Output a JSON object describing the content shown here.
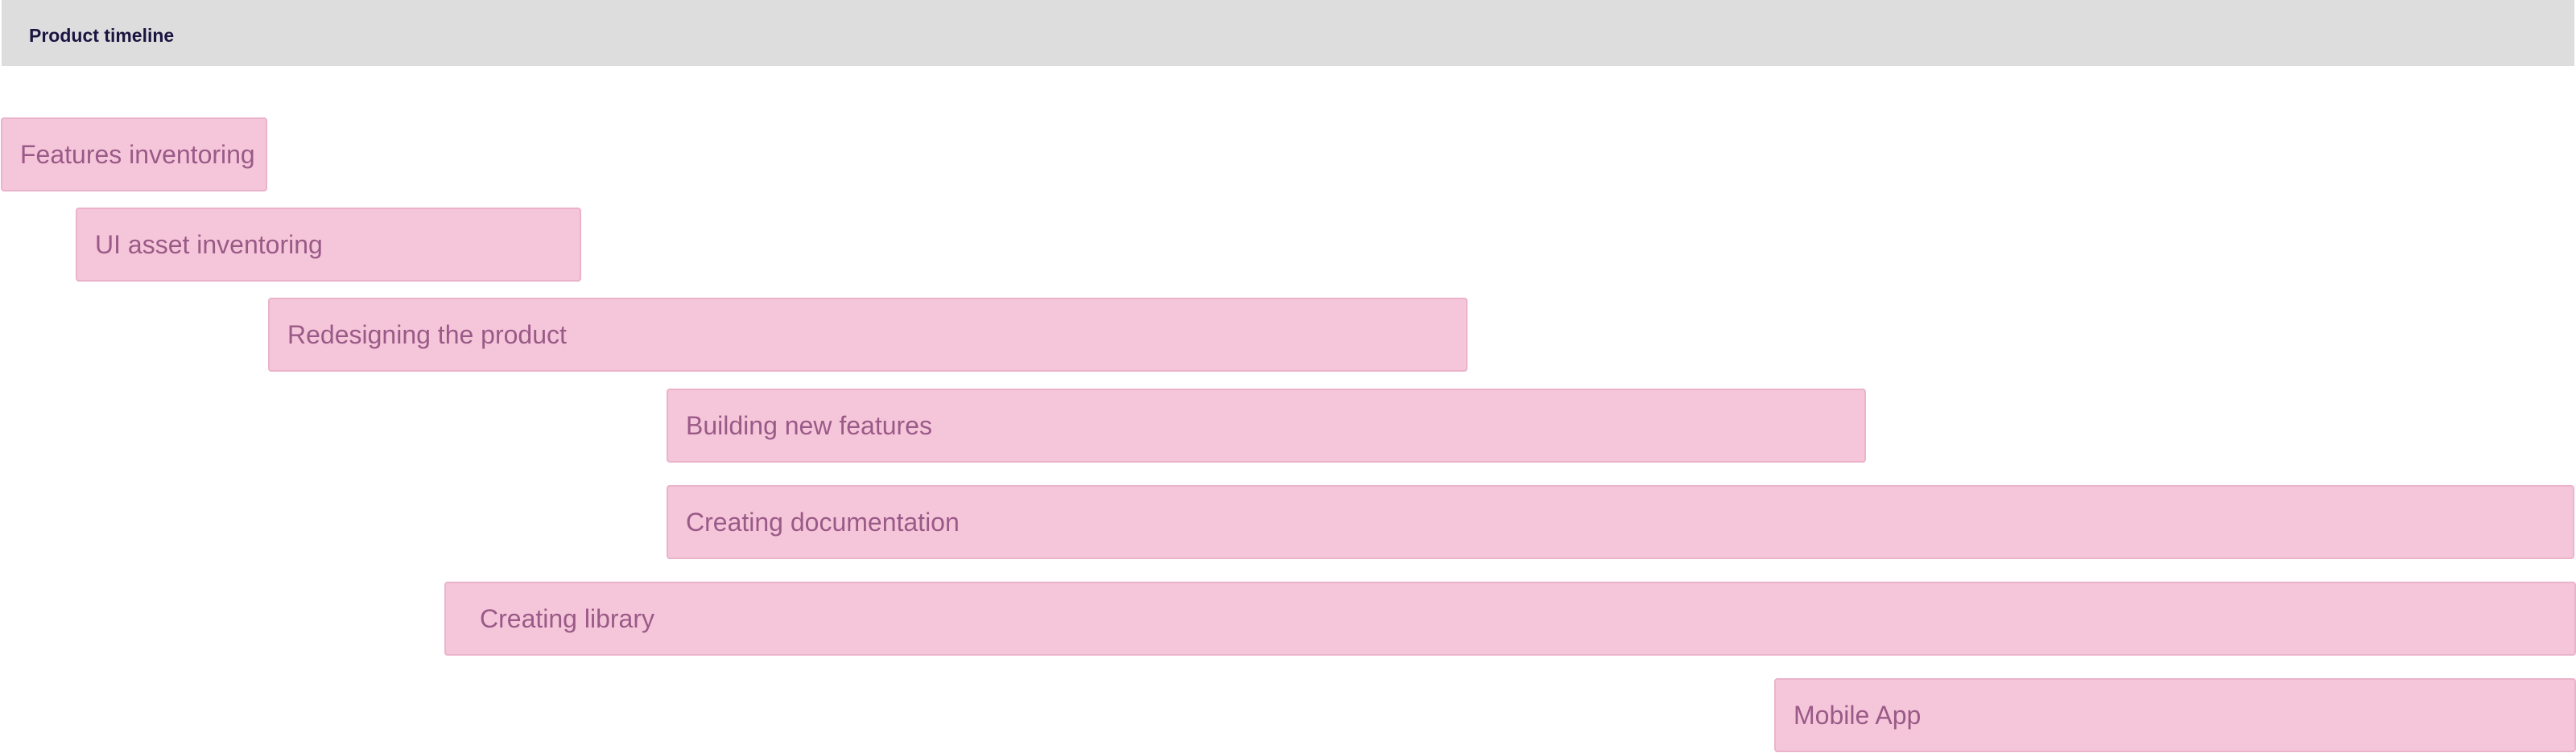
{
  "header": {
    "title": "Product timeline"
  },
  "colors": {
    "header_bg": "#dddddd",
    "header_text": "#1a1440",
    "bar_bg": "#f5c6d9",
    "bar_border": "#eab3c9",
    "bar_text": "#9a5a88"
  },
  "timeline": {
    "items": [
      {
        "label": "Features inventoring"
      },
      {
        "label": "UI asset inventoring"
      },
      {
        "label": "Redesigning the product"
      },
      {
        "label": "Building new features"
      },
      {
        "label": "Creating documentation"
      },
      {
        "label": "Creating library"
      },
      {
        "label": "Mobile App"
      }
    ]
  }
}
